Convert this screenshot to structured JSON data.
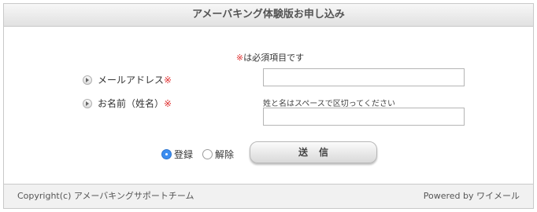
{
  "header": {
    "title": "アメーバキング体験版お申し込み"
  },
  "required_note": {
    "mark": "※",
    "text": "は必須項目です"
  },
  "fields": {
    "email": {
      "label": "メールアドレス",
      "mark": "※",
      "value": ""
    },
    "name": {
      "label": "お名前（姓名）",
      "mark": "※",
      "hint": "姓と名はスペースで区切ってください",
      "value": ""
    }
  },
  "actions": {
    "register_label": "登録",
    "cancel_label": "解除",
    "selected": "register",
    "submit_label": "送信"
  },
  "footer": {
    "copyright": "Copyright(c) アメーバキングサポートチーム",
    "powered": "Powered by ワイメール"
  },
  "colors": {
    "required": "#e03030",
    "radio_selected": "#3b8df0"
  }
}
